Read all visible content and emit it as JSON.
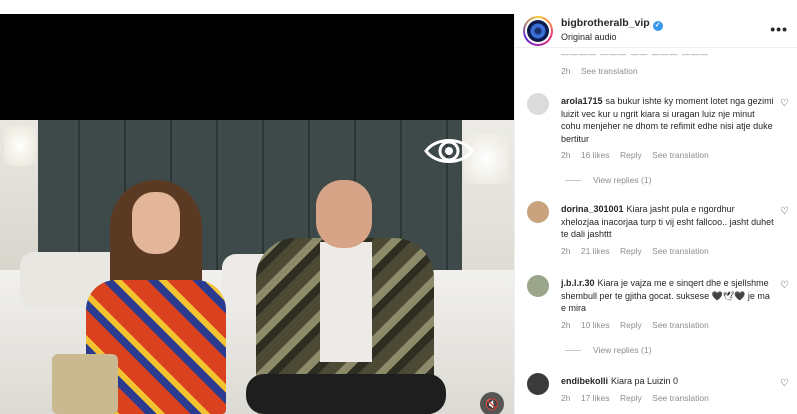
{
  "post": {
    "username": "bigbrotheralb_vip",
    "audio": "Original audio",
    "verified_icon": "verified-badge-icon",
    "more_icon": "more-options-icon",
    "more_label": "•••"
  },
  "video": {
    "logo_icon": "big-brother-eye-icon",
    "mute_icon": "speaker-muted-icon",
    "mute_glyph": "🔇"
  },
  "partial_comment": {
    "text_fragment": "———— ——— —— ——— ———",
    "time": "2h",
    "see_translation": "See translation"
  },
  "comments": [
    {
      "username": "arola1715",
      "text": "sa bukur ishte ky moment lotet nga gezimi luizit vec kur u ngrit kiara si uragan luiz nje minut cohu menjeher ne dhom te refimit edhe nisi atje duke bertitur",
      "time": "2h",
      "likes": "16 likes",
      "reply": "Reply",
      "see_translation": "See translation",
      "view_replies": "View replies (1)"
    },
    {
      "username": "dorina_301001",
      "text": "Kiara jasht pula e ngordhur xhelozjaa inacorjaa turp ti vij esht fallcoo.. jasht duhet te dali jashttt",
      "time": "2h",
      "likes": "21 likes",
      "reply": "Reply",
      "see_translation": "See translation"
    },
    {
      "username": "j.b.l.r.30",
      "text": "Kiara je vajza me e sinqert dhe e sjellshme shembull per te gjitha gocat. suksese 🖤🕊🖤 je ma e mira",
      "time": "2h",
      "likes": "10 likes",
      "reply": "Reply",
      "see_translation": "See translation",
      "view_replies": "View replies (1)"
    },
    {
      "username": "endibekolli",
      "text": "Kiara pa Luizin 0",
      "time": "2h",
      "likes": "17 likes",
      "reply": "Reply",
      "see_translation": "See translation"
    }
  ],
  "colors": {
    "accent_blue": "#3897f0",
    "muted_text": "#8e8e8e",
    "primary_text": "#262626"
  }
}
